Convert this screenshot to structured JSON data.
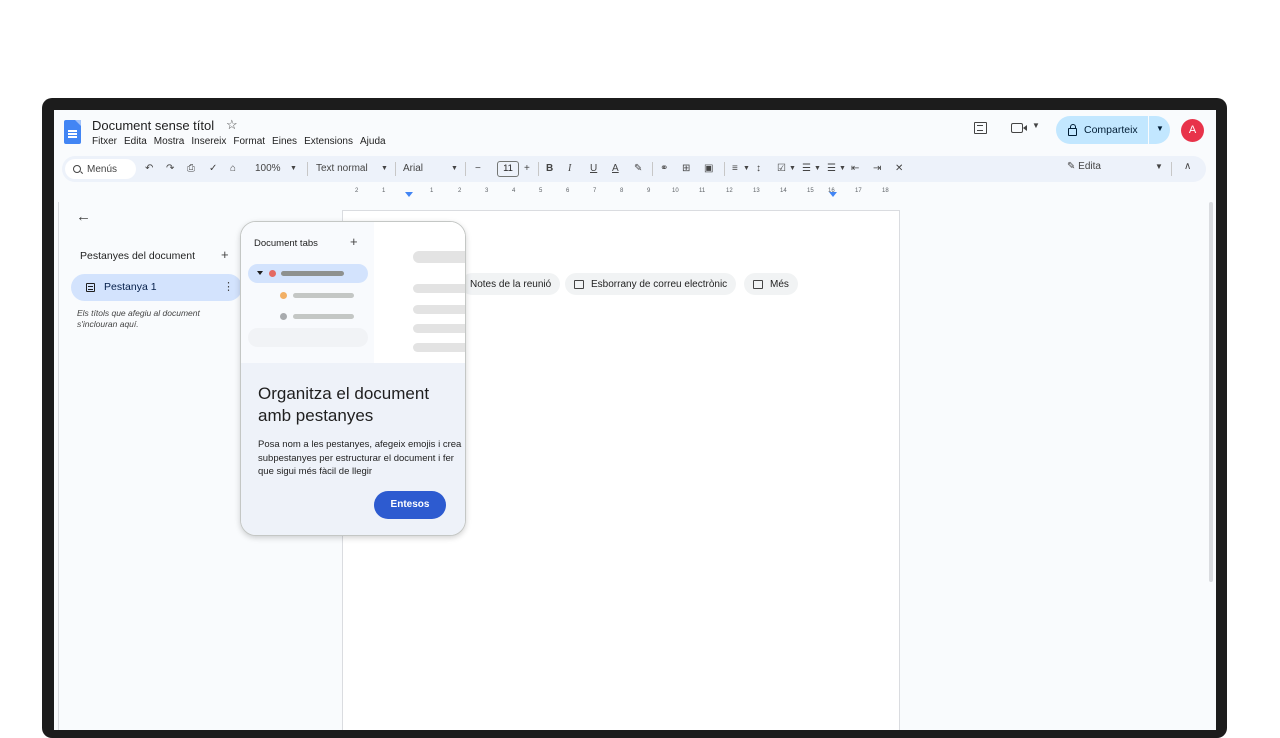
{
  "document": {
    "title": "Document sense títol",
    "menu": [
      "Fitxer",
      "Edita",
      "Mostra",
      "Insereix",
      "Format",
      "Eines",
      "Extensions",
      "Ajuda"
    ]
  },
  "header": {
    "share_label": "Comparteix",
    "avatar_letter": "A"
  },
  "toolbar": {
    "menus_label": "Menús",
    "zoom": "100%",
    "style": "Text normal",
    "font": "Arial",
    "font_size": "11",
    "edit_mode": "Edita"
  },
  "ruler": {
    "ticks": [
      "2",
      "1",
      "1",
      "2",
      "3",
      "4",
      "5",
      "6",
      "7",
      "8",
      "9",
      "10",
      "11",
      "12",
      "13",
      "14",
      "15",
      "16",
      "17",
      "18"
    ]
  },
  "sidebar": {
    "title": "Pestanyes del document",
    "tab_label": "Pestanya 1",
    "hint": "Els títols que afegiu al document s'inclouran aquí."
  },
  "chips": [
    "Notes de la reunió",
    "Esborrany de correu electrònic",
    "Més"
  ],
  "card": {
    "preview_title": "Document tabs",
    "heading": "Organitza el document amb pestanyes",
    "body": "Posa nom a les pestanyes, afegeix emojis i crea subpestanyes per estructurar el document i fer que sigui més fàcil de llegir",
    "button": "Entesos"
  },
  "colors": {
    "accent": "#2d5bd0",
    "share_bg": "#c2e7ff",
    "selected_tab_bg": "#d3e3fd",
    "avatar": "#e8334a"
  }
}
